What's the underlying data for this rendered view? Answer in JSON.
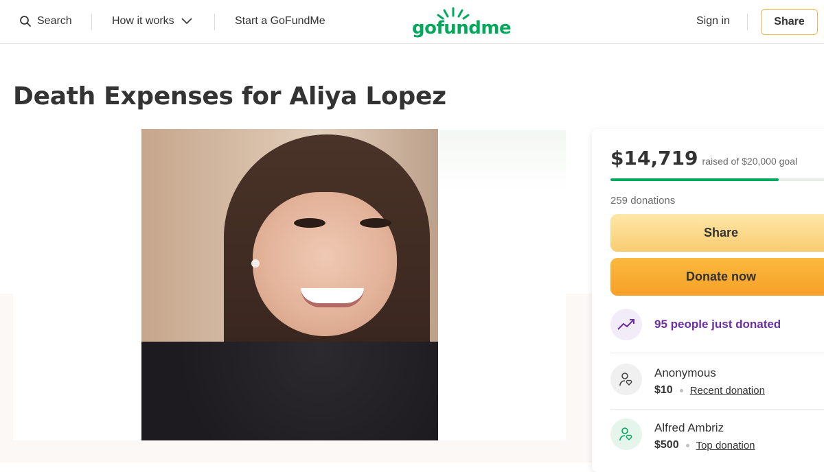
{
  "header": {
    "search_label": "Search",
    "how_label": "How it works",
    "start_label": "Start a GoFundMe",
    "logo_text": "gofundme",
    "signin_label": "Sign in",
    "share_label": "Share",
    "brand_color": "#02a95c"
  },
  "page": {
    "title": "Death Expenses for Aliya Lopez"
  },
  "donation": {
    "raised_amount": "$14,719",
    "raised_goal_text": "raised of $20,000 goal",
    "progress_fraction": 0.7359,
    "donations_count": "259 donations",
    "share_button": "Share",
    "donate_button": "Donate now",
    "trend_text": "95 people just donated",
    "donors": [
      {
        "name": "Anonymous",
        "amount": "$10",
        "tag": "Recent donation"
      },
      {
        "name": "Alfred Ambriz",
        "amount": "$500",
        "tag": "Top donation"
      }
    ],
    "accent_purple": "#6b2fa3",
    "button_yellow": "#f9cc72",
    "button_orange": "#f6a028"
  },
  "icons": {
    "search": "search-icon",
    "chevron": "chevron-down-icon",
    "trend": "trend-up-icon",
    "donor": "donor-heart-icon"
  }
}
